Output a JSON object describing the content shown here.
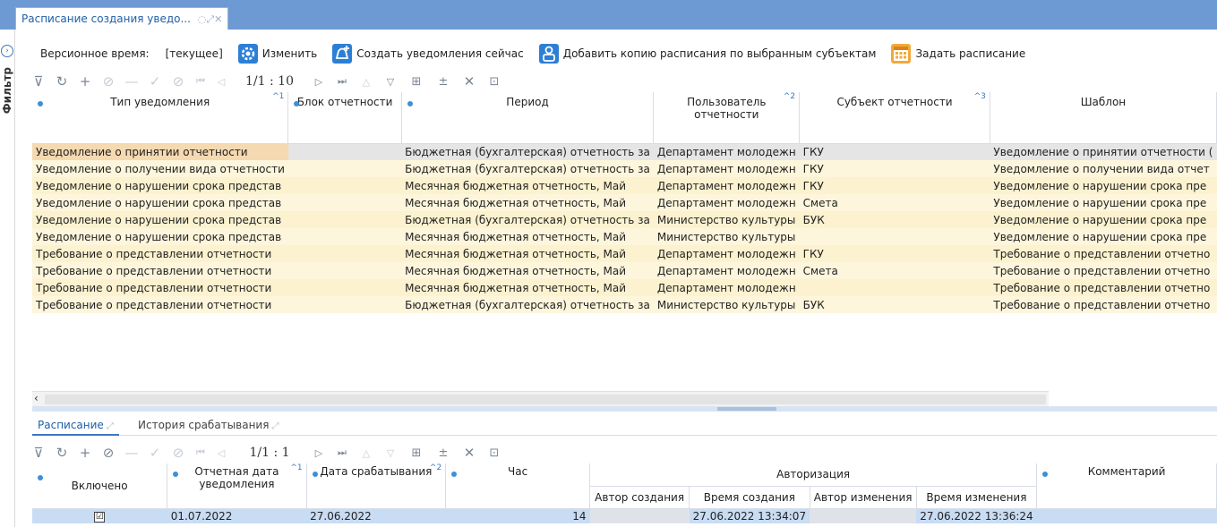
{
  "window": {
    "tab_title": "Расписание создания уведо...",
    "tab_icons": "◌⤢✕"
  },
  "filter_rail": {
    "label": "Фильтр"
  },
  "toolbar": {
    "version_label": "Версионное время:",
    "version_value": "[текущее]",
    "edit_label": "Изменить",
    "create_now_label": "Создать уведомления сейчас",
    "add_copy_label": "Добавить копию расписания по выбранным субъектам",
    "set_schedule_label": "Задать расписание"
  },
  "grid_toolbar": {
    "pager_upper": "1/1 : 10",
    "pager_lower": "1/1 : 1"
  },
  "main_grid": {
    "columns": [
      {
        "label": "Тип уведомления",
        "sort": "^1"
      },
      {
        "label": "Блок отчетности",
        "sort": ""
      },
      {
        "label": "Период",
        "sort": ""
      },
      {
        "label": "Пользователь отчетности",
        "sort": "^2"
      },
      {
        "label": "Субъект отчетности",
        "sort": "^3"
      },
      {
        "label": "Шаблон",
        "sort": ""
      }
    ],
    "rows": [
      [
        "Уведомление о принятии отчетности",
        "",
        "Бюджетная (бухгалтерская) отчетность за",
        "Департамент молодежн",
        "ГКУ",
        "Уведомление о принятии отчетности ("
      ],
      [
        "Уведомление о получении вида отчетности",
        "",
        "Бюджетная (бухгалтерская) отчетность за",
        "Департамент молодежн",
        "ГКУ",
        "Уведомление о получении вида отчет"
      ],
      [
        "Уведомление о нарушении срока представ",
        "",
        "Месячная бюджетная отчетность, Май",
        "Департамент молодежн",
        "ГКУ",
        "Уведомление о нарушении срока пре"
      ],
      [
        "Уведомление о нарушении срока представ",
        "",
        "Месячная бюджетная отчетность, Май",
        "Департамент молодежн",
        "Смета",
        "Уведомление о нарушении срока пре"
      ],
      [
        "Уведомление о нарушении срока представ",
        "",
        "Бюджетная (бухгалтерская) отчетность за",
        "Министерство культуры",
        "БУК",
        "Уведомление о нарушении срока пре"
      ],
      [
        "Уведомление о нарушении срока представ",
        "",
        "Месячная бюджетная отчетность, Май",
        "Министерство культуры",
        "",
        "Уведомление о нарушении срока пре"
      ],
      [
        "Требование о представлении отчетности",
        "",
        "Месячная бюджетная отчетность, Май",
        "Департамент молодежн",
        "ГКУ",
        "Требование о представлении отчетно"
      ],
      [
        "Требование о представлении отчетности",
        "",
        "Месячная бюджетная отчетность, Май",
        "Департамент молодежн",
        "Смета",
        "Требование о представлении отчетно"
      ],
      [
        "Требование о представлении отчетности",
        "",
        "Месячная бюджетная отчетность, Май",
        "Департамент молодежн",
        "",
        "Требование о представлении отчетно"
      ],
      [
        "Требование о представлении отчетности",
        "",
        "Бюджетная (бухгалтерская) отчетность за",
        "Министерство культуры",
        "БУК",
        "Требование о представлении отчетно"
      ]
    ]
  },
  "bottom_tabs": {
    "schedule": "Расписание",
    "history": "История срабатывания"
  },
  "schedule_grid": {
    "col_enabled": "Включено",
    "col_report_date": "Отчетная дата уведомления",
    "col_trigger_date": "Дата срабатывания",
    "col_hour": "Час",
    "group_auth": "Авторизация",
    "col_created_by": "Автор создания",
    "col_created_at": "Время создания",
    "col_modified_by": "Автор изменения",
    "col_modified_at": "Время изменения",
    "col_comment": "Комментарий",
    "sort_report_date": "^1",
    "sort_trigger_date": "^2",
    "row": {
      "checked_glyph": "☑",
      "report_date": "01.07.2022",
      "trigger_date": "27.06.2022",
      "hour": "14",
      "created_at": "27.06.2022 13:34:07",
      "modified_at": "27.06.2022 13:36:24"
    }
  }
}
